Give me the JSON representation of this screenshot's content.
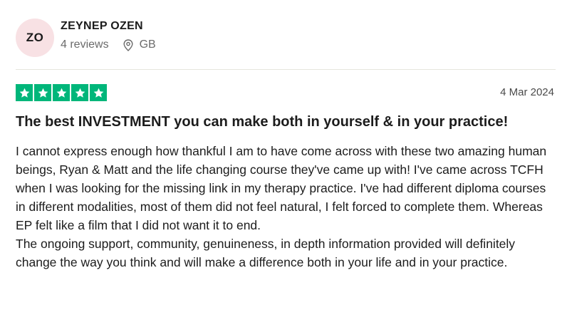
{
  "reviewer": {
    "initials": "ZO",
    "name": "ZEYNEP OZEN",
    "review_count": "4 reviews",
    "country": "GB",
    "location_icon": "location-pin-icon"
  },
  "review": {
    "rating": 5,
    "rating_color": "#00b67a",
    "date": "4 Mar 2024",
    "title": "The best INVESTMENT you can make both in yourself & in your practice!",
    "paragraphs": [
      "I cannot express enough how thankful I am to have come across with these two amazing human beings, Ryan & Matt and the life changing course they've came up with! I've came across TCFH when I was looking for the missing link in my therapy practice. I've had different diploma courses in different modalities, most of them did not feel natural, I felt forced to complete them. Whereas EP felt like a film that I did not want it to end.",
      "The ongoing support, community, genuineness, in depth information provided will definitely change the way you think and will make a difference both in your life and in your practice."
    ]
  }
}
